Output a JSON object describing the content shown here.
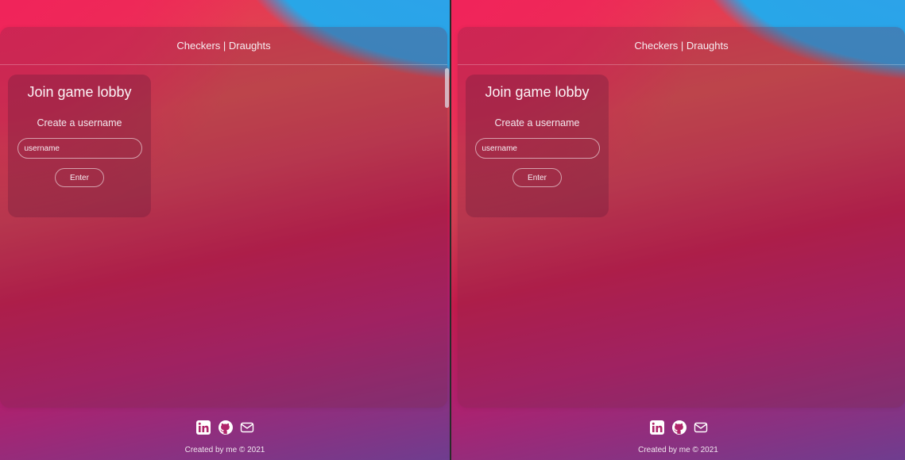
{
  "header": {
    "title": "Checkers | Draughts"
  },
  "lobby": {
    "heading": "Join game lobby",
    "subheading": "Create a username",
    "username_placeholder": "username",
    "enter_label": "Enter"
  },
  "footer": {
    "icons": [
      "linkedin-icon",
      "github-icon",
      "mail-icon"
    ],
    "credit": "Created by me © 2021"
  }
}
